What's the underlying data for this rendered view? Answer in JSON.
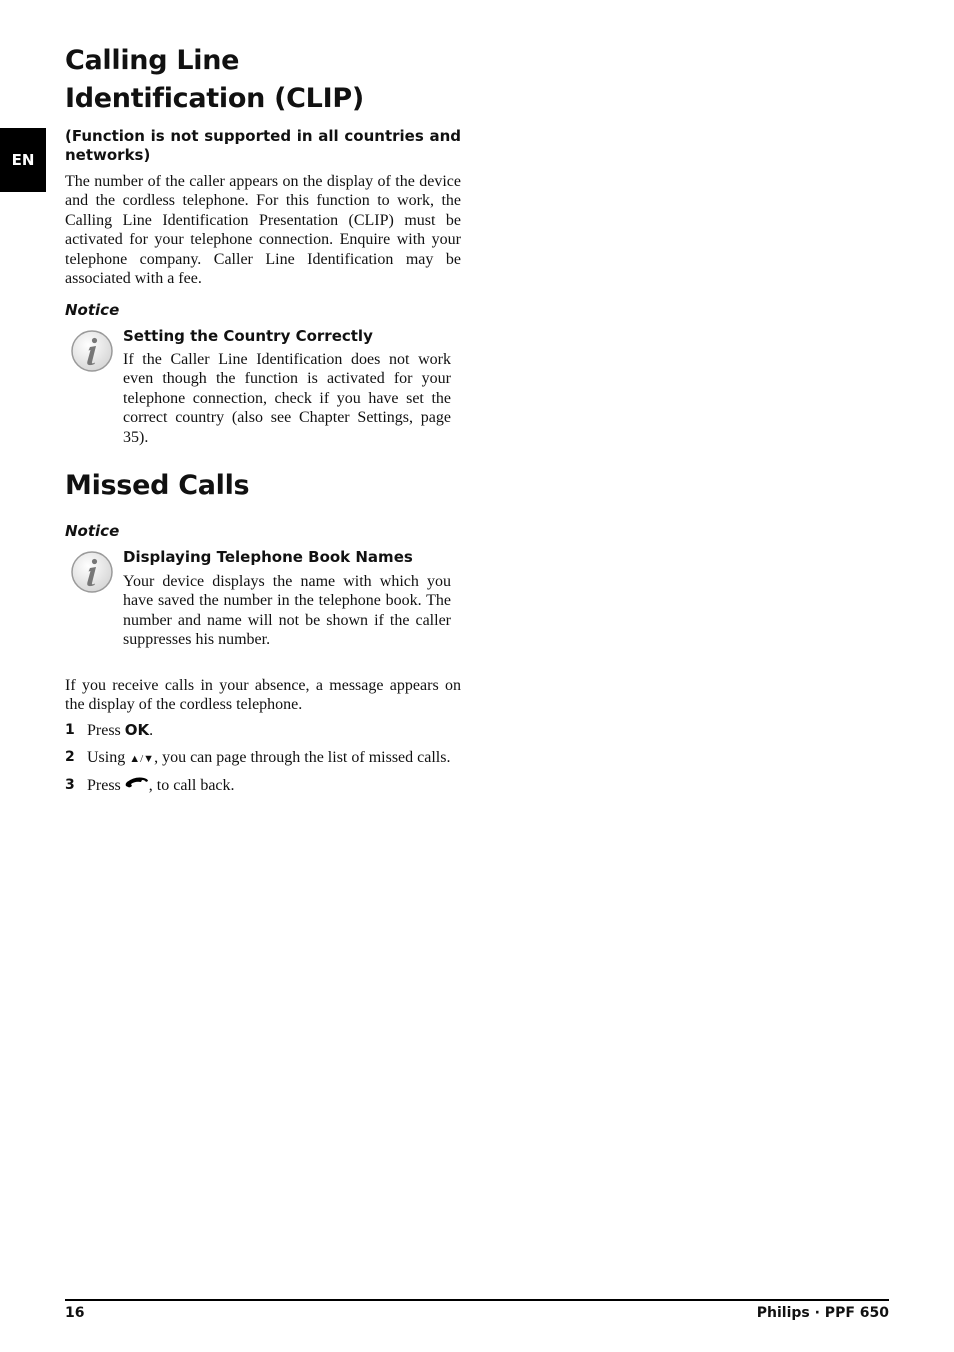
{
  "side_tab": {
    "language": "EN"
  },
  "section_clip": {
    "title": "Calling Line Identification (CLIP)",
    "subheading": "(Function is not supported in all countries and networks)",
    "body": "The number of the caller appears on the display of the device and the cordless telephone. For this function to work, the Calling Line Identification Presentation (CLIP) must be activated for your telephone connection. Enquire with your telephone company. Caller Line Identification may be associated with a fee.",
    "notice": {
      "label": "Notice",
      "icon": "info-icon",
      "title": "Setting the Country Correctly",
      "body": "If the Caller Line Identification does not work even though the function is activated for your telephone connection, check if you have set the correct country (also see Chapter Settings, page 35)."
    }
  },
  "section_missed": {
    "title": "Missed Calls",
    "notice": {
      "label": "Notice",
      "icon": "info-icon",
      "title": "Displaying Telephone Book Names",
      "body": "Your device displays the name with which you have saved the number in the telephone book. The number and name will not be shown if the caller suppresses his number."
    },
    "intro": "If you receive calls in your absence, a message appears on the display of the cordless telephone.",
    "steps": [
      {
        "number": "1",
        "before": "Press ",
        "key": "OK",
        "after": "."
      },
      {
        "number": "2",
        "before": "Using ",
        "key": "▲/▼",
        "after": ", you can page through the list of missed calls."
      },
      {
        "number": "3",
        "before": "Press ",
        "key": "phone-handset-icon",
        "after": ", to call back."
      }
    ]
  },
  "footer": {
    "page_number": "16",
    "product": "Philips · PPF 650"
  }
}
